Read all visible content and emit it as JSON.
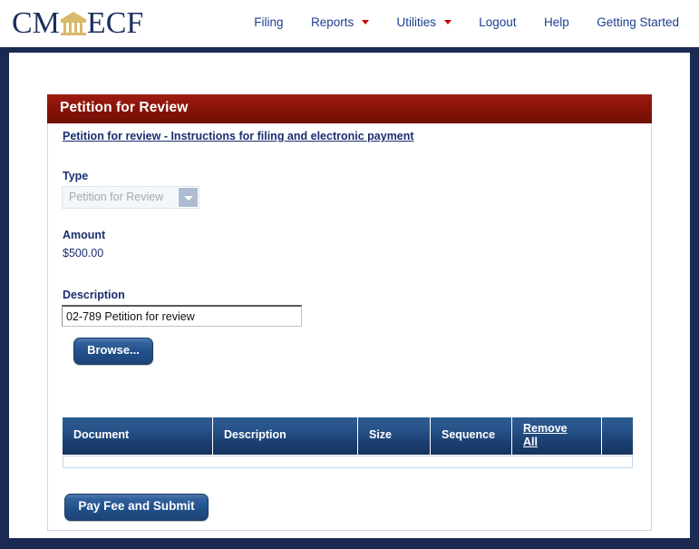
{
  "header": {
    "logo": {
      "text_left": "CM",
      "text_right": "ECF",
      "icon": "courthouse-icon"
    },
    "nav": [
      {
        "label": "Filing",
        "has_caret": false
      },
      {
        "label": "Reports",
        "has_caret": true
      },
      {
        "label": "Utilities",
        "has_caret": true
      },
      {
        "label": "Logout",
        "has_caret": false
      },
      {
        "label": "Help",
        "has_caret": false
      },
      {
        "label": "Getting Started",
        "has_caret": false
      }
    ]
  },
  "panel": {
    "title": "Petition for Review",
    "instructions_link": "Petition for review - Instructions for filing and electronic payment",
    "type": {
      "label": "Type",
      "selected": "Petition for Review",
      "disabled": true
    },
    "amount": {
      "label": "Amount",
      "value": "$500.00"
    },
    "description": {
      "label": "Description",
      "value": "02-789 Petition for review",
      "placeholder": ""
    },
    "browse_button": "Browse...",
    "submit_button": "Pay Fee and Submit",
    "table": {
      "columns": [
        "Document",
        "Description",
        "Size",
        "Sequence",
        "Remove All"
      ],
      "rows": []
    }
  },
  "colors": {
    "brand_navy": "#1b2f5e",
    "frame_navy": "#1b2a52",
    "title_red": "#8d1409",
    "link_blue": "#1b3f8f",
    "caret_red": "#cc0000",
    "button_blue": "#21508a",
    "table_header_blue": "#27548a",
    "logo_gold": "#d9b96a"
  }
}
